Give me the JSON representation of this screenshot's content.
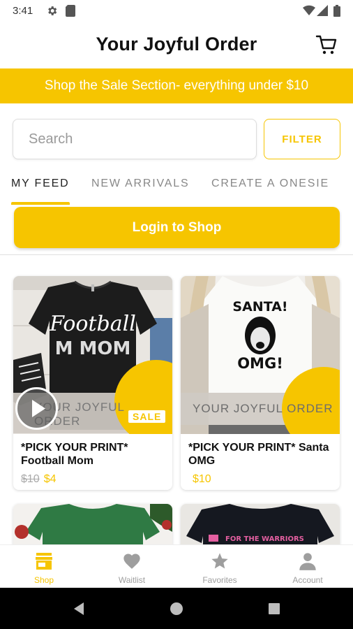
{
  "status_bar": {
    "time": "3:41"
  },
  "header": {
    "title": "Your Joyful Order",
    "cart_icon": "cart-icon"
  },
  "banner": {
    "text": "Shop the Sale Section- everything under $10"
  },
  "search": {
    "placeholder": "Search",
    "value": ""
  },
  "filter": {
    "label": "FILTER"
  },
  "tabs": [
    {
      "label": "MY FEED",
      "active": true
    },
    {
      "label": "NEW ARRIVALS",
      "active": false
    },
    {
      "label": "CREATE A ONESIE",
      "active": false
    }
  ],
  "login": {
    "label": "Login to Shop"
  },
  "products": [
    {
      "name": "*PICK YOUR PRINT* Football Mom",
      "price_old": "$10",
      "price": "$4",
      "badge": "SALE",
      "watermark": "YOUR JOYFUL ORDER",
      "shirt_text_1": "Football",
      "shirt_text_2": "M MOM",
      "has_video": true
    },
    {
      "name": "*PICK YOUR PRINT* Santa OMG",
      "price_old": "",
      "price": "$10",
      "badge": "",
      "watermark": "YOUR JOYFUL ORDER",
      "shirt_text_1": "SANTA!",
      "shirt_text_2": "OMG!",
      "has_video": false
    }
  ],
  "partial_cards": [
    {
      "shirt_text": ""
    },
    {
      "shirt_text": "FOR THE WARRIORS"
    }
  ],
  "bottom_nav": [
    {
      "label": "Shop",
      "icon": "store-icon",
      "active": true
    },
    {
      "label": "Waitlist",
      "icon": "heart-icon",
      "active": false
    },
    {
      "label": "Favorites",
      "icon": "star-icon",
      "active": false
    },
    {
      "label": "Account",
      "icon": "person-icon",
      "active": false
    }
  ],
  "colors": {
    "accent": "#f6c500",
    "text": "#111111",
    "muted": "#9e9e9e"
  }
}
